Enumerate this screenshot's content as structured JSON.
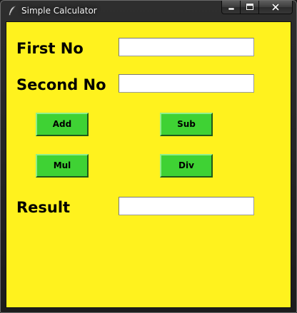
{
  "window": {
    "title": "Simple Calculator",
    "app_icon": "feather-icon"
  },
  "caption_buttons": {
    "minimize_icon": "minimize-icon",
    "maximize_icon": "maximize-icon",
    "close_icon": "close-icon"
  },
  "form": {
    "first_label": "First No",
    "first_value": "",
    "second_label": "Second No",
    "second_value": "",
    "result_label": "Result",
    "result_value": ""
  },
  "buttons": {
    "add": "Add",
    "sub": "Sub",
    "mul": "Mul",
    "div": "Div"
  },
  "colors": {
    "background": "#fff21e",
    "button": "#3fd234",
    "titlebar": "#2a2a2a"
  }
}
